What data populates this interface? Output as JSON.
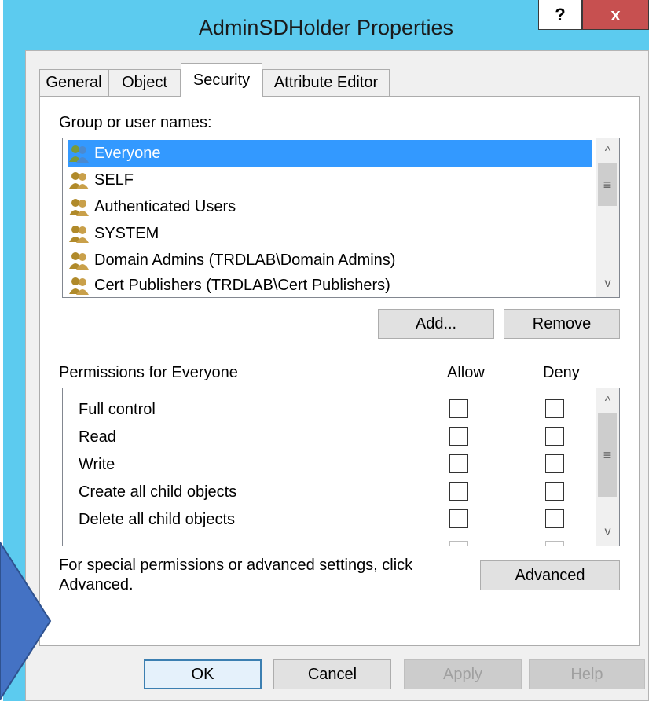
{
  "window": {
    "title": "AdminSDHolder Properties",
    "help_glyph": "?",
    "close_glyph": "x"
  },
  "tabs": [
    {
      "label": "General"
    },
    {
      "label": "Object"
    },
    {
      "label": "Security"
    },
    {
      "label": "Attribute Editor"
    }
  ],
  "security": {
    "group_label": "Group or user names:",
    "users": [
      {
        "name": "Everyone",
        "selected": true
      },
      {
        "name": "SELF"
      },
      {
        "name": "Authenticated Users"
      },
      {
        "name": "SYSTEM"
      },
      {
        "name": "Domain Admins (TRDLAB\\Domain Admins)"
      },
      {
        "name": "Cert Publishers (TRDLAB\\Cert Publishers)"
      }
    ],
    "add_label": "Add...",
    "remove_label": "Remove",
    "permissions_label": "Permissions for Everyone",
    "allow_header": "Allow",
    "deny_header": "Deny",
    "permissions": [
      {
        "name": "Full control",
        "allow": false,
        "deny": false
      },
      {
        "name": "Read",
        "allow": false,
        "deny": false
      },
      {
        "name": "Write",
        "allow": false,
        "deny": false
      },
      {
        "name": "Create all child objects",
        "allow": false,
        "deny": false
      },
      {
        "name": "Delete all child objects",
        "allow": false,
        "deny": false
      }
    ],
    "advanced_text_line1": "For special permissions or advanced settings, click",
    "advanced_text_line2": "Advanced.",
    "advanced_label": "Advanced",
    "scroll_thumb_glyph": "≡",
    "scroll_up_glyph": "^",
    "scroll_down_glyph": "v"
  },
  "footer": {
    "ok_label": "OK",
    "cancel_label": "Cancel",
    "apply_label": "Apply",
    "help_label": "Help"
  },
  "colors": {
    "titlebar": "#5ccbef",
    "selection": "#3399ff",
    "close_button": "#c75050",
    "callout_arrow": "#4472c4"
  }
}
